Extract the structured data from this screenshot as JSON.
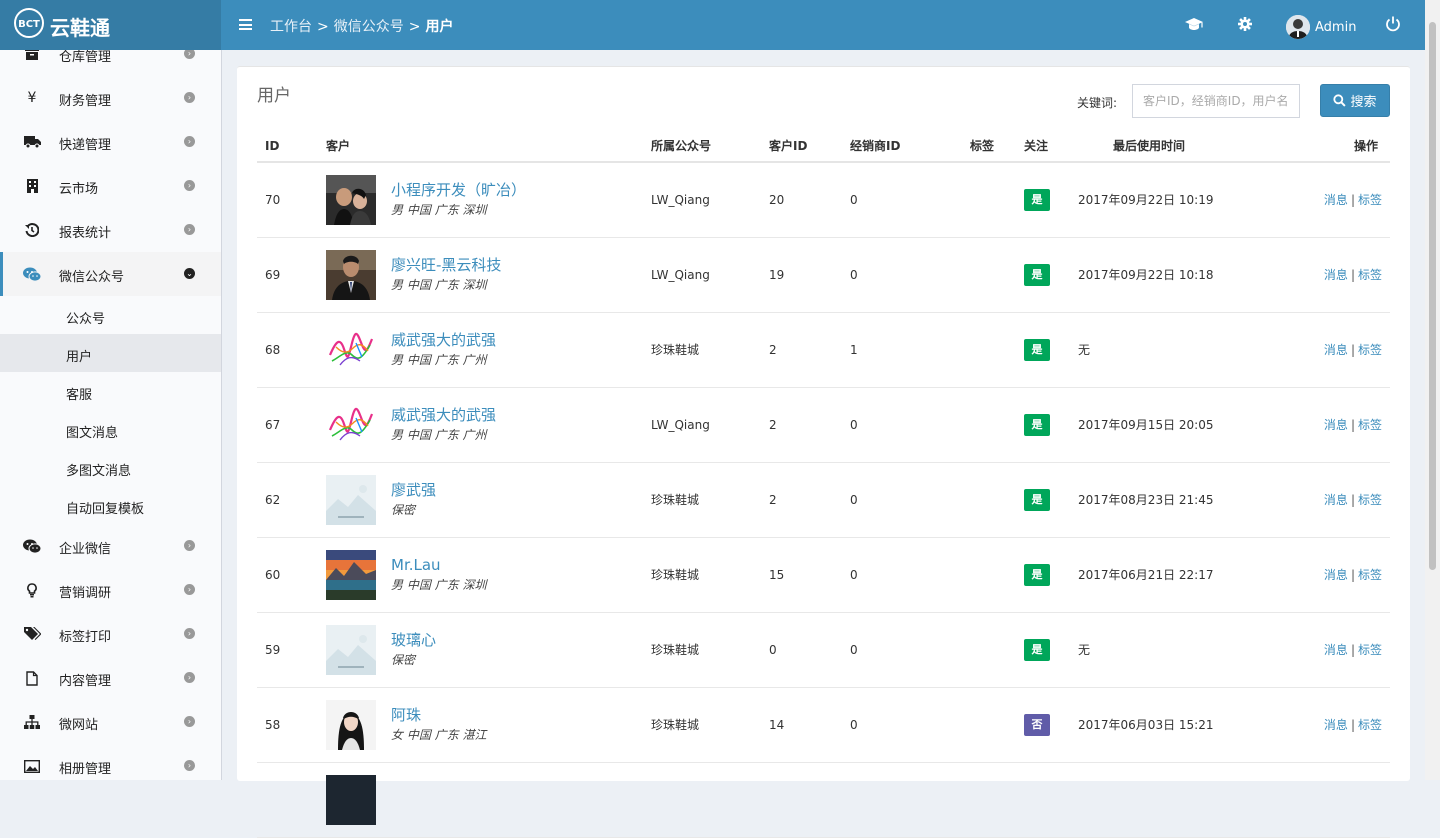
{
  "app": {
    "logo_badge": "BCT",
    "name": "云鞋通"
  },
  "header": {
    "breadcrumb": [
      "工作台",
      "微信公众号",
      "用户"
    ],
    "separator": ">",
    "user_name": "Admin",
    "icons": [
      "graduation-cap-icon",
      "gear-icon",
      "power-icon"
    ]
  },
  "sidebar": {
    "items": [
      {
        "label": "仓库管理",
        "icon": "archive-icon"
      },
      {
        "label": "财务管理",
        "icon": "yen-icon",
        "glyph": "¥"
      },
      {
        "label": "快递管理",
        "icon": "truck-icon"
      },
      {
        "label": "云市场",
        "icon": "building-icon"
      },
      {
        "label": "报表统计",
        "icon": "history-icon"
      },
      {
        "label": "微信公众号",
        "icon": "wechat-icon",
        "active": true
      },
      {
        "label": "企业微信",
        "icon": "wechat-icon"
      },
      {
        "label": "营销调研",
        "icon": "lightbulb-icon"
      },
      {
        "label": "标签打印",
        "icon": "tags-icon"
      },
      {
        "label": "内容管理",
        "icon": "file-icon"
      },
      {
        "label": "微网站",
        "icon": "sitemap-icon"
      },
      {
        "label": "相册管理",
        "icon": "image-icon"
      }
    ],
    "submenu": [
      "公众号",
      "用户",
      "客服",
      "图文消息",
      "多图文消息",
      "自动回复模板"
    ],
    "submenu_selected": "用户"
  },
  "page": {
    "title": "用户",
    "keyword_label": "关键词:",
    "search_placeholder": "客户ID，经销商ID，用户名",
    "search_button": "搜索"
  },
  "table": {
    "headers": [
      "ID",
      "客户",
      "所属公众号",
      "客户ID",
      "经销商ID",
      "标签",
      "关注",
      "最后使用时间",
      "操作"
    ],
    "action_message": "消息",
    "action_tag": "标签",
    "action_separator": "|",
    "rows": [
      {
        "id": "70",
        "name": "小程序开发（旷冶）",
        "info": "男 中国 广东 深圳",
        "avatar": "photo-couple",
        "account": "LW_Qiang",
        "customer_id": "20",
        "dealer_id": "0",
        "tag": "",
        "follow": "是",
        "last_used": "2017年09月22日 10:19"
      },
      {
        "id": "69",
        "name": "廖兴旺-黑云科技",
        "info": "男 中国 广东 深圳",
        "avatar": "photo-suit",
        "account": "LW_Qiang",
        "customer_id": "19",
        "dealer_id": "0",
        "tag": "",
        "follow": "是",
        "last_used": "2017年09月22日 10:18"
      },
      {
        "id": "68",
        "name": "威武强大的武强",
        "info": "男 中国 广东 广州",
        "avatar": "graffiti",
        "account": "珍珠鞋城",
        "customer_id": "2",
        "dealer_id": "1",
        "tag": "",
        "follow": "是",
        "last_used": "无"
      },
      {
        "id": "67",
        "name": "威武强大的武强",
        "info": "男 中国 广东 广州",
        "avatar": "graffiti",
        "account": "LW_Qiang",
        "customer_id": "2",
        "dealer_id": "0",
        "tag": "",
        "follow": "是",
        "last_used": "2017年09月15日 20:05"
      },
      {
        "id": "62",
        "name": "廖武强",
        "info": "保密",
        "avatar": "placeholder",
        "account": "珍珠鞋城",
        "customer_id": "2",
        "dealer_id": "0",
        "tag": "",
        "follow": "是",
        "last_used": "2017年08月23日 21:45"
      },
      {
        "id": "60",
        "name": "Mr.Lau",
        "info": "男 中国 广东 深圳",
        "avatar": "photo-landscape",
        "account": "珍珠鞋城",
        "customer_id": "15",
        "dealer_id": "0",
        "tag": "",
        "follow": "是",
        "last_used": "2017年06月21日 22:17"
      },
      {
        "id": "59",
        "name": "玻璃心",
        "info": "保密",
        "avatar": "placeholder",
        "account": "珍珠鞋城",
        "customer_id": "0",
        "dealer_id": "0",
        "tag": "",
        "follow": "是",
        "last_used": "无"
      },
      {
        "id": "58",
        "name": "阿珠",
        "info": "女 中国 广东 湛江",
        "avatar": "photo-woman",
        "account": "珍珠鞋城",
        "customer_id": "14",
        "dealer_id": "0",
        "tag": "",
        "follow": "否",
        "last_used": "2017年06月03日 15:21"
      },
      {
        "id": "",
        "name": "",
        "info": "",
        "avatar": "photo-dark",
        "account": "",
        "customer_id": "",
        "dealer_id": "",
        "tag": "",
        "follow": "",
        "last_used": ""
      }
    ]
  },
  "colors": {
    "header": "#3c8dbc",
    "logo_bar": "#357ca5",
    "link": "#3c8dbc",
    "follow_yes": "#00a65a",
    "follow_no": "#605ca8"
  }
}
